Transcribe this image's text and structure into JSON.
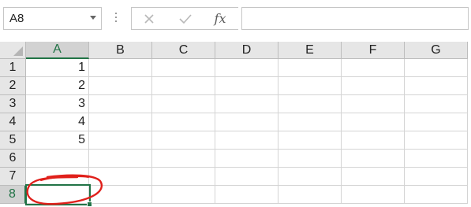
{
  "name_box": {
    "value": "A8"
  },
  "formula_bar": {
    "cancel_icon": "close-icon",
    "enter_icon": "check-icon",
    "function_label": "fx",
    "value": ""
  },
  "columns": [
    "A",
    "B",
    "C",
    "D",
    "E",
    "F",
    "G"
  ],
  "rows": [
    "1",
    "2",
    "3",
    "4",
    "5",
    "6",
    "7",
    "8"
  ],
  "cells": {
    "A1": "1",
    "A2": "2",
    "A3": "3",
    "A4": "4",
    "A5": "5"
  },
  "selection": {
    "cell": "A8",
    "column": "A",
    "row": "8"
  },
  "colors": {
    "accent": "#217346",
    "annotation": "#e0201b",
    "header_bg": "#e6e6e6",
    "gridline": "#d4d4d4"
  }
}
